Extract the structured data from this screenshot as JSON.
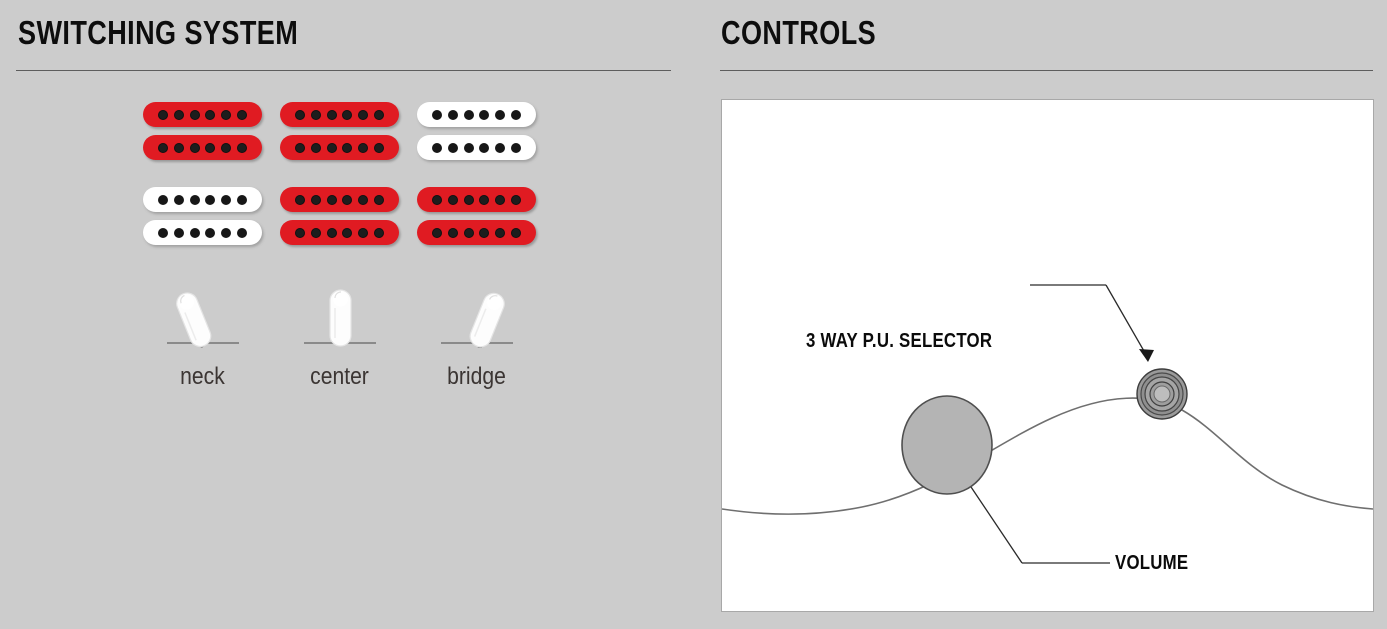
{
  "background_color": "#cccccc",
  "accent_color": "#e01b22",
  "panels": {
    "left": {
      "title": "SWITCHING SYSTEM",
      "pickup_grid": {
        "rows": [
          {
            "cells": [
              {
                "position": "neck",
                "color": "red",
                "poles": 6,
                "coils": 2
              },
              {
                "position": "center",
                "color": "red",
                "poles": 6,
                "coils": 2
              },
              {
                "position": "bridge",
                "color": "white",
                "poles": 6,
                "coils": 2
              }
            ]
          },
          {
            "cells": [
              {
                "position": "neck",
                "color": "white",
                "poles": 6,
                "coils": 2
              },
              {
                "position": "center",
                "color": "red",
                "poles": 6,
                "coils": 2
              },
              {
                "position": "bridge",
                "color": "red",
                "poles": 6,
                "coils": 2
              }
            ]
          }
        ]
      },
      "switches": [
        {
          "label": "neck",
          "icon": "toggle-switch-lever-left-icon",
          "angle": -22
        },
        {
          "label": "center",
          "icon": "toggle-switch-lever-center-icon",
          "angle": 0
        },
        {
          "label": "bridge",
          "icon": "toggle-switch-lever-right-icon",
          "angle": 22
        }
      ]
    },
    "right": {
      "title": "CONTROLS",
      "diagram": {
        "selector_label": "3 WAY P.U. SELECTOR",
        "volume_label": "VOLUME",
        "selector_icon": "rotary-selector-switch-icon",
        "volume_icon": "volume-knob-icon",
        "body_outline_icon": "guitar-body-contour-icon"
      }
    }
  }
}
